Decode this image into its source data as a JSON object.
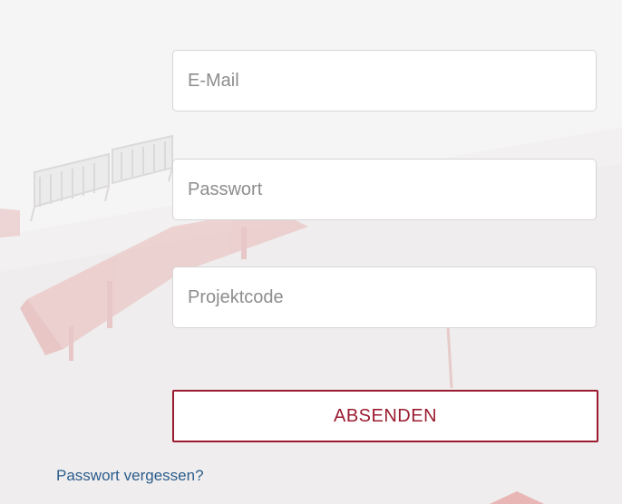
{
  "form": {
    "email": {
      "value": "",
      "placeholder": "E-Mail"
    },
    "password": {
      "value": "",
      "placeholder": "Passwort"
    },
    "project_code": {
      "value": "",
      "placeholder": "Projektcode"
    },
    "submit_label": "ABSENDEN",
    "forgot_password_link": "Passwort vergessen?"
  },
  "colors": {
    "accent": "#9b1c30",
    "link": "#2b5c8c",
    "background": "#f2f0f0",
    "field_border": "#d6d6d6",
    "placeholder": "#8d8d8d"
  }
}
